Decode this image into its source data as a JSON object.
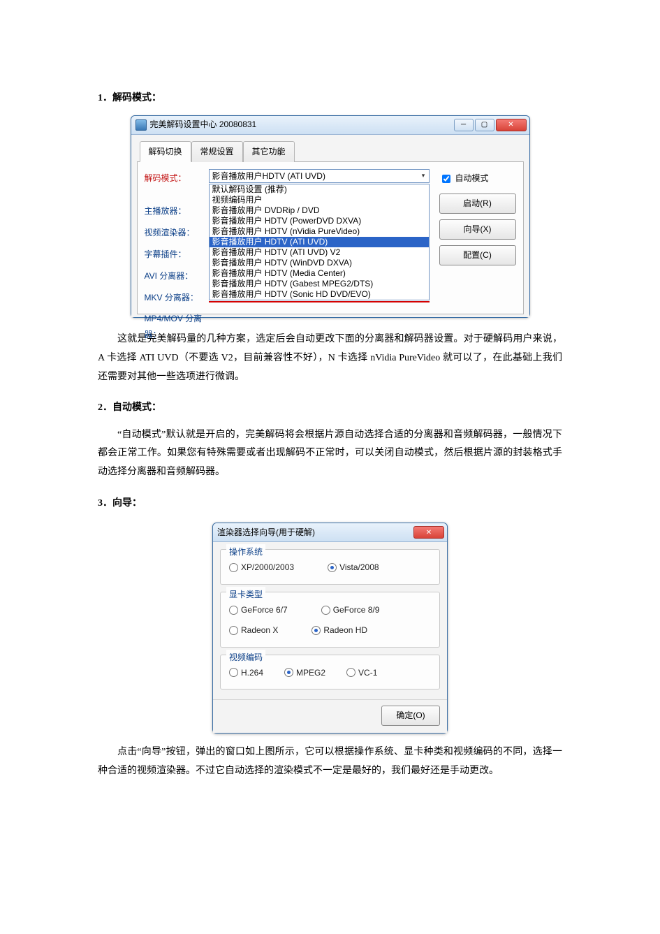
{
  "sections": {
    "s1": "1．解码模式：",
    "s2": "2．自动模式：",
    "s3": "3．向导："
  },
  "para1": "这就是完美解码量的几种方案，选定后会自动更改下面的分离器和解码器设置。对于硬解码用户来说，A 卡选择 ATI UVD（不要选 V2，目前兼容性不好），N 卡选择 nVidia PureVideo 就可以了，在此基础上我们还需要对其他一些选项进行微调。",
  "para2": "“自动模式”默认就是开启的，完美解码将会根据片源自动选择合适的分离器和音频解码器，一般情况下都会正常工作。如果您有特殊需要或者出现解码不正常时，可以关闭自动模式，然后根据片源的封装格式手动选择分离器和音频解码器。",
  "para3": "点击“向导”按钮，弹出的窗口如上图所示，它可以根据操作系统、显卡种类和视频编码的不同，选择一种合适的视频渲染器。不过它自动选择的渲染模式不一定是最好的，我们最好还是手动更改。",
  "win": {
    "title": "完美解码设置中心 20080831",
    "tabs": [
      "解码切换",
      "常规设置",
      "其它功能"
    ],
    "labels": {
      "mode": "解码模式：",
      "player": "主播放器：",
      "renderer": "视频渲染器：",
      "subtitle": "字幕插件：",
      "avi": "AVI 分离器：",
      "mkv": "MKV 分离器：",
      "mp4": "MP4/MOV 分离器："
    },
    "combo_selected": "影音播放用户HDTV (ATI UVD)",
    "dropdown_options": [
      "默认解码设置 (推荐)",
      "视频编码用户",
      "影音播放用户 DVDRip / DVD",
      "影音播放用户 HDTV (PowerDVD DXVA)",
      "影音播放用户 HDTV (nVidia PureVideo)",
      "影音播放用户 HDTV (ATI UVD)",
      "影音播放用户 HDTV (ATI UVD) V2",
      "影音播放用户 HDTV (WinDVD DXVA)",
      "影音播放用户 HDTV (Media Center)",
      "影音播放用户 HDTV (Gabest MPEG2/DTS)",
      "影音播放用户 HDTV (Sonic HD DVD/EVO)"
    ],
    "auto_checkbox": "自动模式",
    "buttons": {
      "start": "启动(R)",
      "wizard": "向导(X)",
      "config": "配置(C)"
    }
  },
  "dlg": {
    "title": "渲染器选择向导(用于硬解)",
    "grp_os": "操作系统",
    "os_options": [
      "XP/2000/2003",
      "Vista/2008"
    ],
    "grp_gpu": "显卡类型",
    "gpu_options": [
      "GeForce 6/7",
      "GeForce 8/9",
      "Radeon X",
      "Radeon HD"
    ],
    "grp_codec": "视频编码",
    "codec_options": [
      "H.264",
      "MPEG2",
      "VC-1"
    ],
    "ok": "确定(O)"
  }
}
